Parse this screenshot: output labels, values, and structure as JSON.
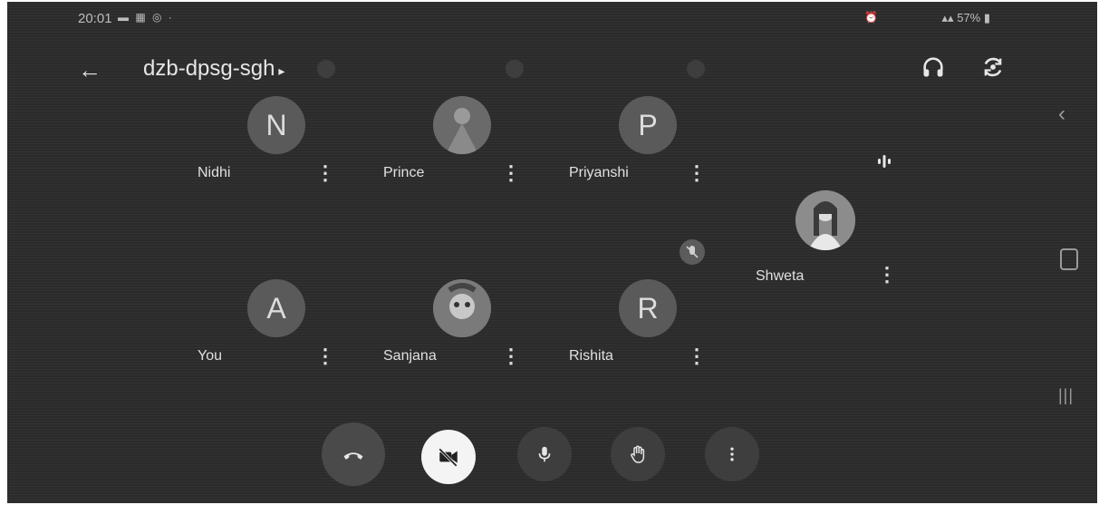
{
  "status_bar": {
    "time": "20:01",
    "battery": "57%",
    "notification_icons": [
      "gallery-icon",
      "photo-icon",
      "screen-record-icon",
      "dot-icon"
    ],
    "system_icons": [
      "alarm-icon",
      "wifi-icon",
      "signal-icon",
      "signal-icon",
      "battery-icon"
    ]
  },
  "header": {
    "title": "dzb-dpsg-sgh",
    "back_icon": "arrow-left-icon",
    "audio_icon": "headphones-icon",
    "switch_camera_icon": "switch-camera-icon"
  },
  "participants": [
    {
      "name": "Nidhi",
      "initial": "N",
      "avatar": "initial"
    },
    {
      "name": "Prince",
      "initial": "",
      "avatar": "photo"
    },
    {
      "name": "Priyanshi",
      "initial": "P",
      "avatar": "initial"
    },
    {
      "name": "You",
      "initial": "A",
      "avatar": "initial"
    },
    {
      "name": "Sanjana",
      "initial": "",
      "avatar": "photo"
    },
    {
      "name": "Rishita",
      "initial": "R",
      "avatar": "initial"
    }
  ],
  "featured": {
    "name": "Shweta",
    "avatar": "photo",
    "speaking": true
  },
  "controls": [
    {
      "id": "leave",
      "icon": "end-call-icon"
    },
    {
      "id": "camera",
      "icon": "camera-off-icon"
    },
    {
      "id": "mic",
      "icon": "microphone-icon"
    },
    {
      "id": "raise_hand",
      "icon": "hand-icon"
    },
    {
      "id": "more",
      "icon": "more-vertical-icon"
    }
  ],
  "colors": {
    "background": "#2b2b2b",
    "avatar": "#5a5a5a",
    "camera_button": "#f4f4f4"
  }
}
